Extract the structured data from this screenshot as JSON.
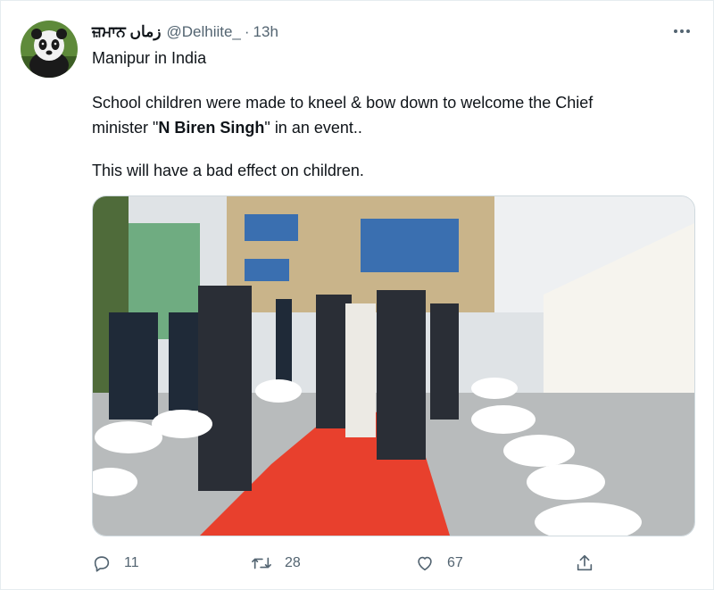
{
  "tweet": {
    "display_name": "ਜ਼ਮਾਨ زماں",
    "handle": "@Delhiite_",
    "separator": "·",
    "time": "13h",
    "location_line": "Manipur in India",
    "body_line1": "School children were made to kneel & bow down to welcome the Chief",
    "body_line2_prefix": "minister \"",
    "body_line2_bold": "N Biren Singh",
    "body_line2_suffix": "\" in an event..",
    "body_line3": "This will have a bad effect on children."
  },
  "actions": {
    "reply_count": "11",
    "retweet_count": "28",
    "like_count": "67"
  },
  "icons": {
    "avatar": "panda-avatar",
    "more": "more-icon",
    "reply": "reply-icon",
    "retweet": "retweet-icon",
    "like": "heart-icon",
    "share": "share-icon"
  },
  "colors": {
    "text": "#0f1419",
    "secondary": "#536471",
    "border": "#e6ecf0",
    "carpet": "#e8402d"
  }
}
